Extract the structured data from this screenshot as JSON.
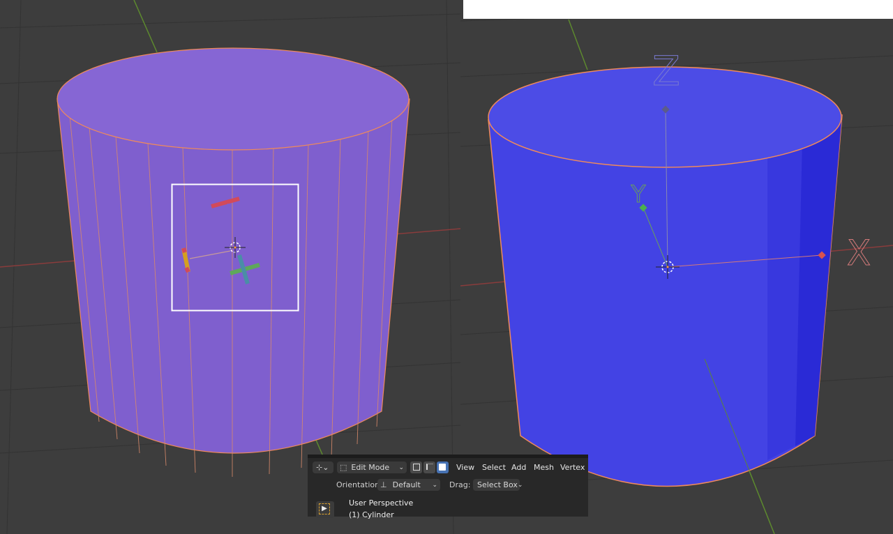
{
  "header": {
    "mode": "Edit Mode",
    "menu": [
      "View",
      "Select",
      "Add",
      "Mesh",
      "Vertex"
    ],
    "orientation_label": "Orientation:",
    "orientation_value": "Default",
    "drag_label": "Drag:",
    "drag_value": "Select Box"
  },
  "viewport_overlay": {
    "perspective": "User Perspective",
    "object": "(1) Cylinder"
  },
  "gizmo_labels": {
    "x": "X",
    "y": "Y",
    "z": "Z"
  },
  "colors": {
    "viewport_bg": "#3d3d3d",
    "left_cylinder": "#8566d4",
    "right_cylinder": "#4545e6",
    "edge": "#f08a5a",
    "x_axis": "#d9534f",
    "y_axis": "#6a9c2e",
    "z_axis": "#6f74c9",
    "header_bg": "#282828",
    "active_button": "#4772b3"
  },
  "icons": [
    "transform-gizmo-icon",
    "edit-mode-icon",
    "vertex-select-icon",
    "edge-select-icon",
    "face-select-icon",
    "orientation-icon",
    "select-cursor-icon"
  ]
}
